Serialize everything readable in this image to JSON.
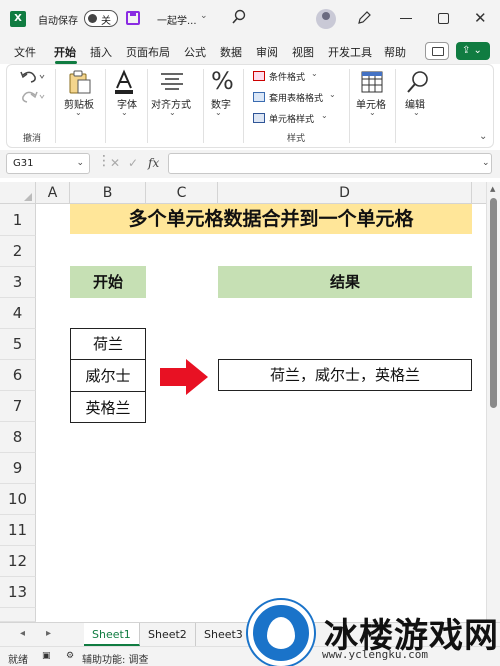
{
  "titlebar": {
    "autosave_label": "自动保存",
    "toggle_text": "关",
    "doc_title": "一起学..."
  },
  "menu": {
    "tabs": [
      "文件",
      "开始",
      "插入",
      "页面布局",
      "公式",
      "数据",
      "审阅",
      "视图",
      "开发工具",
      "帮助"
    ],
    "active": "开始"
  },
  "ribbon": {
    "undo_group": "撤消",
    "clipboard": "剪贴板",
    "font": "字体",
    "alignment": "对齐方式",
    "number": "数字",
    "conditional_format": "条件格式",
    "table_format": "套用表格格式",
    "cell_style": "单元格样式",
    "styles_group": "样式",
    "cells": "单元格",
    "editing": "编辑"
  },
  "formula_bar": {
    "namebox": "G31",
    "fx": "fx"
  },
  "grid": {
    "columns": [
      "A",
      "B",
      "C",
      "D"
    ],
    "rows": [
      "1",
      "2",
      "3",
      "4",
      "5",
      "6",
      "7",
      "8",
      "9",
      "10",
      "11",
      "12",
      "13"
    ],
    "title": "多个单元格数据合并到一个单元格",
    "header_start": "开始",
    "header_result": "结果",
    "data_items": [
      "荷兰",
      "威尔士",
      "英格兰"
    ],
    "result": "荷兰，威尔士，英格兰",
    "title_fill": "#ffe699",
    "header_fill": "#c6e0b4",
    "arrow_color": "#e81123"
  },
  "sheets": {
    "tabs": [
      "Sheet1",
      "Sheet2",
      "Sheet3"
    ],
    "active": "Sheet1"
  },
  "status": {
    "ready": "就绪",
    "accessibility": "辅助功能: 调查"
  },
  "watermark": {
    "text": "冰楼游戏网",
    "url": "www.yclengku.com"
  }
}
